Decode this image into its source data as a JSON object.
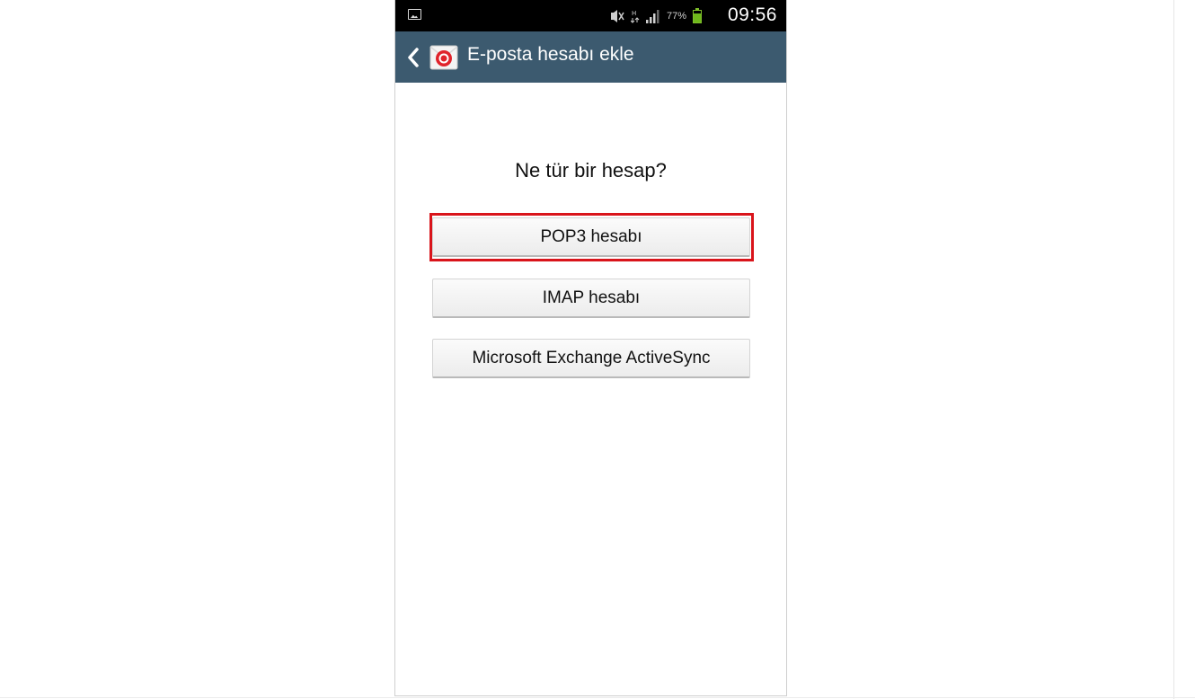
{
  "status_bar": {
    "time": "09:56",
    "battery_percent": "77%",
    "battery_level": 0.77,
    "icons": [
      "picture-icon",
      "mute-icon",
      "data-icon",
      "signal-icon",
      "battery-icon"
    ]
  },
  "action_bar": {
    "title": "E-posta hesabı ekle",
    "background": "#3c5a6f",
    "icons": [
      "back-chevron-icon",
      "email-app-icon"
    ]
  },
  "main": {
    "question": "Ne tür bir hesap?",
    "options": [
      {
        "label": "POP3 hesabı",
        "highlighted": true
      },
      {
        "label": "IMAP hesabı",
        "highlighted": false
      },
      {
        "label": "Microsoft Exchange ActiveSync",
        "highlighted": false
      }
    ],
    "highlight_color": "#d9141b"
  }
}
